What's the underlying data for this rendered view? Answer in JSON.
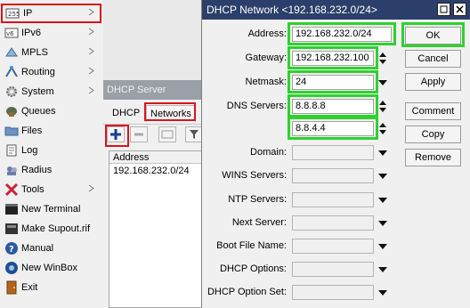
{
  "menu": {
    "items": [
      {
        "label": "IP",
        "icon": "ip-icon",
        "submenu": true,
        "selected": true
      },
      {
        "label": "IPv6",
        "icon": "ipv6-icon",
        "submenu": true
      },
      {
        "label": "MPLS",
        "icon": "mpls-icon",
        "submenu": true
      },
      {
        "label": "Routing",
        "icon": "routing-icon",
        "submenu": true
      },
      {
        "label": "System",
        "icon": "gear-icon",
        "submenu": true
      },
      {
        "label": "Queues",
        "icon": "queues-icon"
      },
      {
        "label": "Files",
        "icon": "folder-icon"
      },
      {
        "label": "Log",
        "icon": "log-icon"
      },
      {
        "label": "Radius",
        "icon": "radius-icon"
      },
      {
        "label": "Tools",
        "icon": "tools-icon",
        "submenu": true
      },
      {
        "label": "New Terminal",
        "icon": "terminal-icon"
      },
      {
        "label": "Make Supout.rif",
        "icon": "supout-icon"
      },
      {
        "label": "Manual",
        "icon": "help-icon"
      },
      {
        "label": "New WinBox",
        "icon": "winbox-icon"
      },
      {
        "label": "Exit",
        "icon": "exit-icon"
      }
    ]
  },
  "server_window": {
    "title": "DHCP Server",
    "tabs": [
      "DHCP",
      "Networks"
    ],
    "active_tab": "Networks",
    "table": {
      "columns": [
        "Address"
      ],
      "rows": [
        [
          "192.168.232.0/24"
        ]
      ]
    }
  },
  "network_dialog": {
    "title": "DHCP Network <192.168.232.0/24>",
    "fields": {
      "address": {
        "label": "Address:",
        "value": "192.168.232.0/24"
      },
      "gateway": {
        "label": "Gateway:",
        "value": "192.168.232.100"
      },
      "netmask": {
        "label": "Netmask:",
        "value": "24"
      },
      "dns": {
        "label": "DNS Servers:",
        "values": [
          "8.8.8.8",
          "8.8.4.4"
        ]
      },
      "domain": {
        "label": "Domain:",
        "value": ""
      },
      "wins": {
        "label": "WINS Servers:",
        "value": ""
      },
      "ntp": {
        "label": "NTP Servers:",
        "value": ""
      },
      "next_server": {
        "label": "Next Server:",
        "value": ""
      },
      "boot_file": {
        "label": "Boot File Name:",
        "value": ""
      },
      "dhcp_options": {
        "label": "DHCP Options:",
        "value": ""
      },
      "dhcp_option_set": {
        "label": "DHCP Option Set:",
        "value": ""
      }
    },
    "buttons": {
      "ok": "OK",
      "cancel": "Cancel",
      "apply": "Apply",
      "comment": "Comment",
      "copy": "Copy",
      "remove": "Remove"
    }
  },
  "colors": {
    "highlight_red": "#d9141c",
    "highlight_green": "#2fd12f",
    "dialog_title_bg": "#2b3f6a",
    "inactive_title_bg": "#9aa0a7"
  }
}
